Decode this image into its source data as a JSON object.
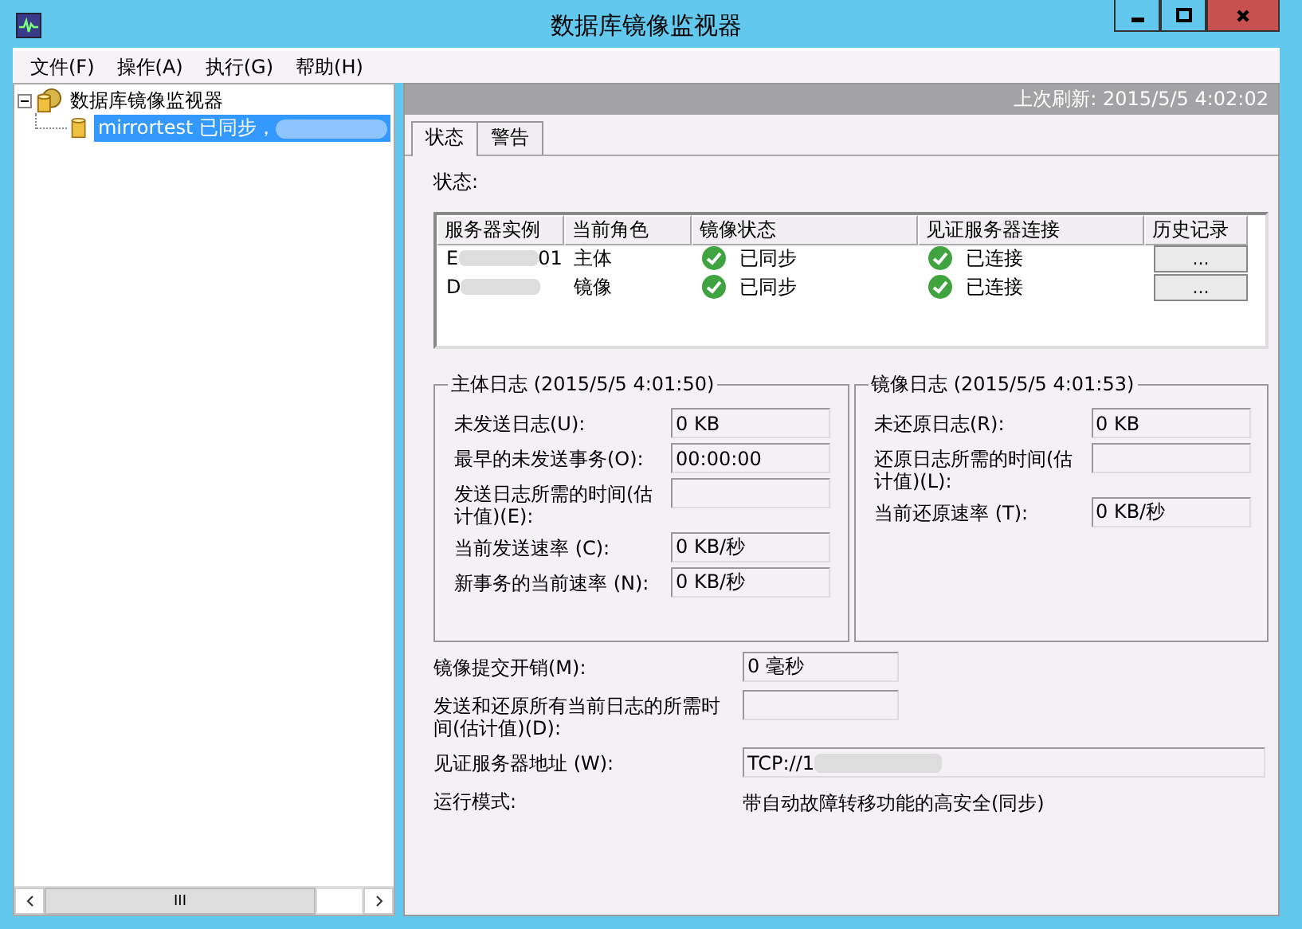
{
  "window": {
    "title": "数据库镜像监视器"
  },
  "menu": [
    "文件(F)",
    "操作(A)",
    "执行(G)",
    "帮助(H)"
  ],
  "tree": {
    "label": "数据库镜像监视器",
    "expanded": true,
    "children": [
      {
        "label": "mirrortest 已同步，",
        "selected": true,
        "redacted": true
      }
    ]
  },
  "refresh": "上次刷新: 2015/5/5 4:02:02",
  "tabs": [
    {
      "label": "状态",
      "selected": true
    },
    {
      "label": "警告",
      "selected": false
    }
  ],
  "status_label": "状态:",
  "table": {
    "columns": [
      "服务器实例",
      "当前角色",
      "镜像状态",
      "见证服务器连接",
      "历史记录"
    ],
    "rows": [
      {
        "instance_start": "E",
        "instance_end": "01",
        "role": "主体",
        "mirror_state": "已同步",
        "witness": "已连接",
        "history": "..."
      },
      {
        "instance_start": "D",
        "role": "镜像",
        "mirror_state": "已同步",
        "witness": "已连接",
        "history": "..."
      }
    ]
  },
  "groups": [
    {
      "title": "主体日志  (2015/5/5 4:01:50)",
      "fields": [
        {
          "label": "未发送日志(U):",
          "value": "0 KB"
        },
        {
          "label": "最早的未发送事务(O):",
          "value": "00:00:00"
        },
        {
          "label": "发送日志所需的时间(估计值)(E):"
        },
        {
          "label": "当前发送速率 (C):",
          "value": "0 KB/秒"
        },
        {
          "label": "新事务的当前速率 (N):",
          "value": "0 KB/秒"
        }
      ]
    },
    {
      "title": "镜像日志  (2015/5/5 4:01:53)",
      "fields": [
        {
          "label": "未还原日志(R):",
          "value": "0 KB"
        },
        {
          "label": "还原日志所需的时间(估计值)(L):"
        },
        {
          "label": "当前还原速率 (T):",
          "value": "0 KB/秒"
        }
      ]
    }
  ],
  "bottom_fields": [
    {
      "kind": "box",
      "label": "镜像提交开销(M):",
      "value": "0 毫秒"
    },
    {
      "kind": "box",
      "label": "发送和还原所有当前日志的所需时间(估计值)(D):"
    },
    {
      "kind": "wide",
      "label": "见证服务器地址 (W):",
      "value": "TCP://1",
      "redacted": true
    },
    {
      "kind": "text",
      "label": "运行模式:",
      "value": "带自动故障转移功能的高安全(同步)"
    }
  ],
  "scrollbar": {
    "thumb": "III"
  }
}
